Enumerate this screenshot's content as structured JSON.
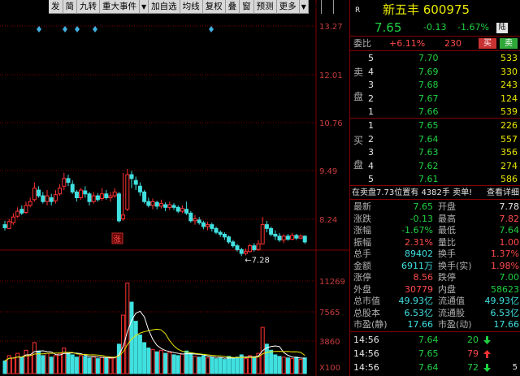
{
  "toolbar": {
    "items": [
      "发",
      "简",
      "九转",
      "重大事件",
      "▼",
      "加自选",
      "均线",
      "复权",
      "叠",
      "窗",
      "预测",
      "更多",
      "▼",
      "⇒",
      "◀"
    ]
  },
  "chart": {
    "price_ticks": [
      "13.27",
      "12.01",
      "10.76",
      "9.49",
      "8.24"
    ],
    "vol_ticks": [
      "11269",
      "7565",
      "3860",
      "X100"
    ],
    "low_marker": "←7.28",
    "rise_marker": "涨",
    "colors": {
      "up": "#ff3232",
      "down": "#40e0e0",
      "grid": "#800000",
      "ma_white": "#ffffff",
      "ma_yellow": "#e8e800"
    }
  },
  "panel": {
    "r_label": "R",
    "stock_name": "新五丰 600975",
    "price": "7.65",
    "change": "-0.13",
    "change_pct": "-1.67%",
    "tag": "陆",
    "weibi_label": "委比",
    "weibi_value": "+6.11%",
    "weibi_num": "230",
    "buy_btn": "买",
    "sell_btn": "卖",
    "sell_side_label": [
      "卖",
      "盘"
    ],
    "buy_side_label": [
      "买",
      "盘"
    ],
    "asks": [
      {
        "n": "5",
        "price": "7.70",
        "vol": "533"
      },
      {
        "n": "4",
        "price": "7.69",
        "vol": "330"
      },
      {
        "n": "3",
        "price": "7.68",
        "vol": "243"
      },
      {
        "n": "2",
        "price": "7.67",
        "vol": "124"
      },
      {
        "n": "1",
        "price": "7.66",
        "vol": "539"
      }
    ],
    "bids": [
      {
        "n": "1",
        "price": "7.65",
        "vol": "226"
      },
      {
        "n": "2",
        "price": "7.64",
        "vol": "557"
      },
      {
        "n": "3",
        "price": "7.63",
        "vol": "356"
      },
      {
        "n": "4",
        "price": "7.62",
        "vol": "274"
      },
      {
        "n": "5",
        "price": "7.61",
        "vol": "586"
      }
    ],
    "notice": "在卖盘7.73位置有 4382手 卖单!",
    "notice_link": "查看详细",
    "stats": [
      [
        "最新",
        "7.65",
        "开盘",
        "7.78"
      ],
      [
        "涨跌",
        "-0.13",
        "最高",
        "7.82"
      ],
      [
        "涨幅",
        "-1.67%",
        "最低",
        "7.64"
      ],
      [
        "振幅",
        "2.31%",
        "量比",
        "1.00"
      ],
      [
        "总手",
        "89402",
        "换手",
        "1.37%"
      ],
      [
        "金额",
        "6911万",
        "换手(实)",
        "1.98%"
      ],
      [
        "涨停",
        "8.56",
        "跌停",
        "7.00"
      ],
      [
        "外盘",
        "30779",
        "内盘",
        "58623"
      ],
      [
        "总市值",
        "49.93亿",
        "流通值",
        "49.93亿"
      ],
      [
        "总股本",
        "6.53亿",
        "流通股",
        "6.53亿"
      ],
      [
        "市盈(静)",
        "17.66",
        "市盈(动)",
        "17.66"
      ]
    ],
    "ticks": [
      {
        "time": "14:56",
        "price": "7.64",
        "vol": "20",
        "dir": "down"
      },
      {
        "time": "14:56",
        "price": "7.65",
        "vol": "79",
        "dir": "up"
      },
      {
        "time": "14:56",
        "price": "7.64",
        "vol": "72",
        "dir": "down"
      }
    ]
  }
}
